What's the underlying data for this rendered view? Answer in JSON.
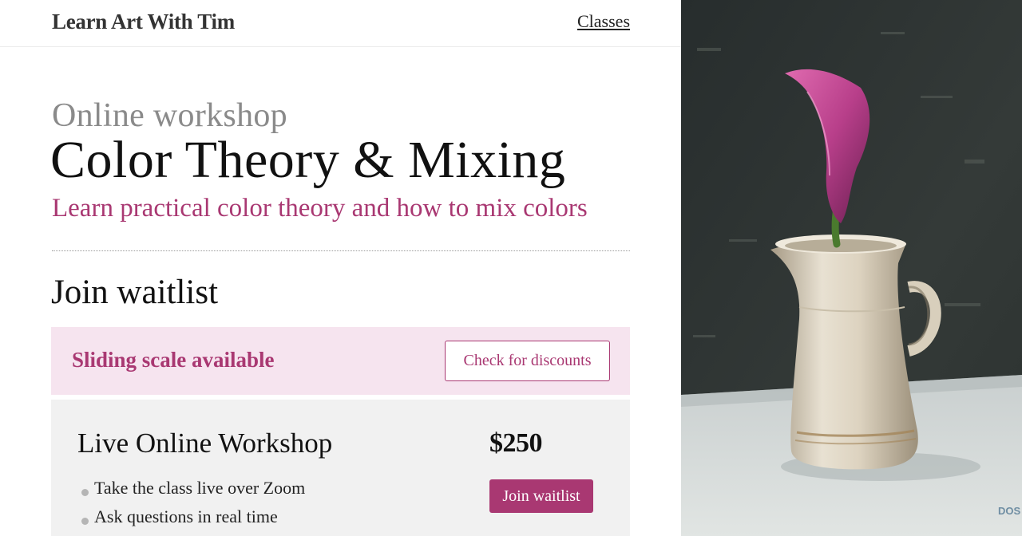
{
  "header": {
    "site_title": "Learn Art With Tim",
    "nav_classes": "Classes"
  },
  "hero": {
    "eyebrow": "Online workshop",
    "title": "Color Theory & Mixing",
    "subtitle": "Learn practical color theory and how to mix colors"
  },
  "waitlist": {
    "section_title": "Join waitlist",
    "banner_text": "Sliding scale available",
    "discount_button": "Check for discounts"
  },
  "card": {
    "title": "Live Online Workshop",
    "price": "$250",
    "features": [
      "Take the class live over Zoom",
      "Ask questions in real time"
    ],
    "join_button": "Join waitlist"
  },
  "painting": {
    "signature": "DOS"
  },
  "colors": {
    "accent": "#a93872",
    "banner_bg": "#f6e4ef",
    "card_bg": "#f1f1f1"
  }
}
